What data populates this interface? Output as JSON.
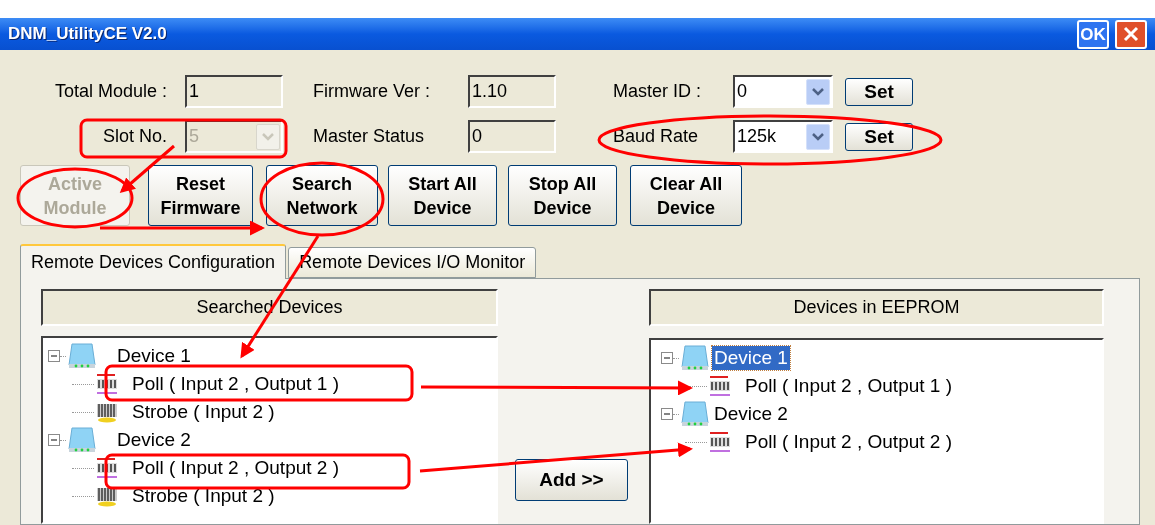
{
  "window": {
    "title": "DNM_UtilityCE V2.0",
    "ok_button": "OK"
  },
  "settings": [
    {
      "kind": "textbox",
      "label": "Total Module :",
      "value": "1"
    },
    {
      "kind": "textbox",
      "label": "Firmware Ver :",
      "value": "1.10"
    },
    {
      "kind": "combo",
      "label": "Master ID :",
      "value": "0",
      "disabled": false,
      "button": "Set"
    },
    {
      "kind": "combo",
      "label": "Slot No.",
      "value": "5",
      "disabled": true
    },
    {
      "kind": "textbox",
      "label": "Master Status",
      "value": "0"
    },
    {
      "kind": "combo",
      "label": "Baud Rate",
      "value": "125k",
      "disabled": false,
      "button": "Set"
    }
  ],
  "buttons": [
    {
      "label": "Active Module",
      "disabled": true
    },
    {
      "label": "Reset Firmware",
      "disabled": false
    },
    {
      "label": "Search Network",
      "disabled": false
    },
    {
      "label": "Start All Device",
      "disabled": false
    },
    {
      "label": "Stop All Device",
      "disabled": false
    },
    {
      "label": "Clear All Device",
      "disabled": false
    }
  ],
  "tabs": [
    {
      "label": "Remote Devices Configuration",
      "selected": true
    },
    {
      "label": "Remote Devices I/O Monitor",
      "selected": false
    }
  ],
  "searched_devices": {
    "header": "Searched Devices",
    "tree": [
      {
        "kind": "device",
        "label": "Device 1",
        "expanded": true,
        "selected": false,
        "children": [
          {
            "kind": "poll",
            "label": "Poll ( Input 2 , Output 1 )",
            "selected": false
          },
          {
            "kind": "strobe",
            "label": "Strobe ( Input 2 )",
            "selected": false
          }
        ]
      },
      {
        "kind": "device",
        "label": "Device 2",
        "expanded": true,
        "selected": false,
        "children": [
          {
            "kind": "poll",
            "label": "Poll ( Input 2 , Output 2 )",
            "selected": false
          },
          {
            "kind": "strobe",
            "label": "Strobe ( Input 2 )",
            "selected": false
          }
        ]
      }
    ]
  },
  "add_button": "Add >>",
  "eeprom_devices": {
    "header": "Devices in EEPROM",
    "tree": [
      {
        "kind": "device",
        "label": "Device 1",
        "expanded": true,
        "selected": true,
        "children": [
          {
            "kind": "poll",
            "label": "Poll ( Input 2 , Output 1 )",
            "selected": false
          }
        ]
      },
      {
        "kind": "device",
        "label": "Device 2",
        "expanded": true,
        "selected": false,
        "children": [
          {
            "kind": "poll",
            "label": "Poll ( Input 2 , Output 2 )",
            "selected": false
          }
        ]
      }
    ]
  }
}
